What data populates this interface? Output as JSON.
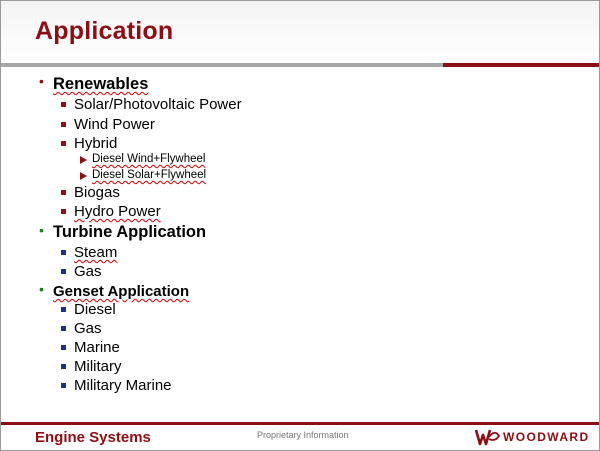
{
  "slide": {
    "title": "Application",
    "colors": {
      "accent": "#8b0f14",
      "green": "#1d7a1d",
      "blue": "#1f2d8b",
      "gray_rule": "#a7a7a7"
    },
    "outline": [
      {
        "text": "Renewables",
        "bullet_color": "#8b0f14",
        "children": [
          {
            "text": "Solar/Photovoltaic Power"
          },
          {
            "text": "Wind Power"
          },
          {
            "text": "Hybrid",
            "children": [
              {
                "text": "Diesel Wind+Flywheel"
              },
              {
                "text": "Diesel Solar+Flywheel"
              }
            ]
          },
          {
            "text": "Biogas"
          },
          {
            "text": "Hydro Power"
          }
        ]
      },
      {
        "text": "Turbine Application",
        "bullet_color": "#1d7a1d",
        "children": [
          {
            "text": "Steam"
          },
          {
            "text": "Gas"
          }
        ]
      },
      {
        "text": "Genset Application",
        "bullet_color": "#1d7a1d",
        "children": [
          {
            "text": "Diesel"
          },
          {
            "text": "Gas"
          },
          {
            "text": "Marine"
          },
          {
            "text": "Military"
          },
          {
            "text": "Military Marine"
          }
        ]
      }
    ]
  },
  "footer": {
    "left_label": "Engine Systems",
    "center_label": "Proprietary Information",
    "logo_text": "WOODWARD",
    "dot_colors": [
      "#2a3d9c",
      "#2e8b2e",
      "#d4a017"
    ]
  }
}
